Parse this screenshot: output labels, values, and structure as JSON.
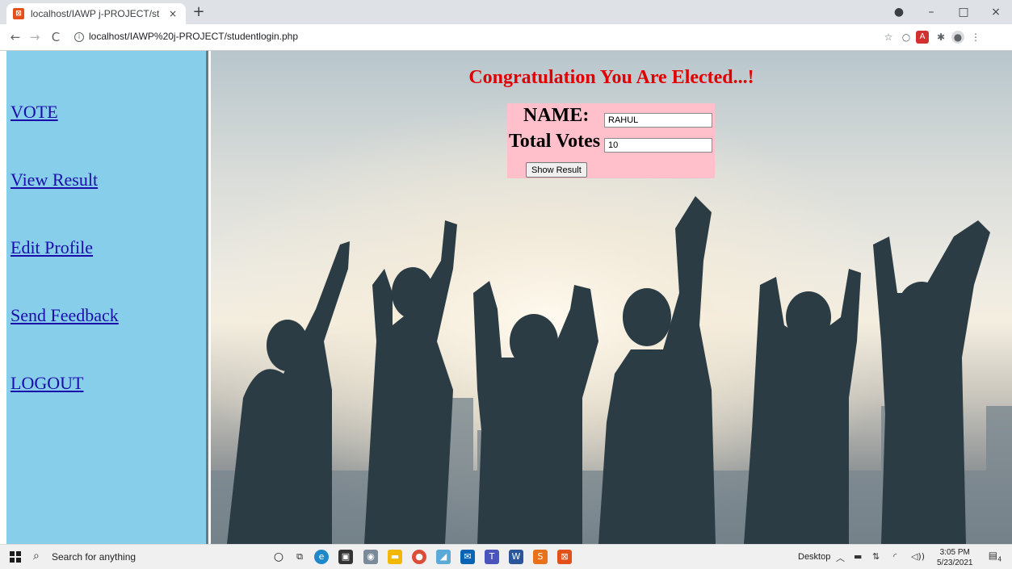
{
  "browser": {
    "tab_title": "localhost/IAWP j-PROJECT/stude",
    "favicon_glyph": "⊠",
    "tab_close": "×",
    "new_tab": "+",
    "url": "localhost/IAWP%20j-PROJECT/studentlogin.php",
    "back": "←",
    "forward": "→",
    "reload": "C",
    "info": "i"
  },
  "sidebar": {
    "links": [
      {
        "label": "VOTE"
      },
      {
        "label": "View Result"
      },
      {
        "label": "Edit Profile"
      },
      {
        "label": "Send Feedback"
      },
      {
        "label": "LOGOUT"
      }
    ]
  },
  "main": {
    "heading": "Congratulation You Are Elected...!",
    "name_label": "NAME:",
    "name_value": "RAHUL",
    "votes_label": "Total Votes",
    "votes_value": "10",
    "button_label": "Show Result"
  },
  "taskbar": {
    "search_text": "Search for anything",
    "desktop_label": "Desktop",
    "time": "3:05 PM",
    "date": "5/23/2021",
    "notification_count": "4"
  },
  "colors": {
    "sidebar_bg": "#87ceeb",
    "card_bg": "#ffc0cb",
    "heading": "#e00000",
    "link": "#1a0dab"
  }
}
